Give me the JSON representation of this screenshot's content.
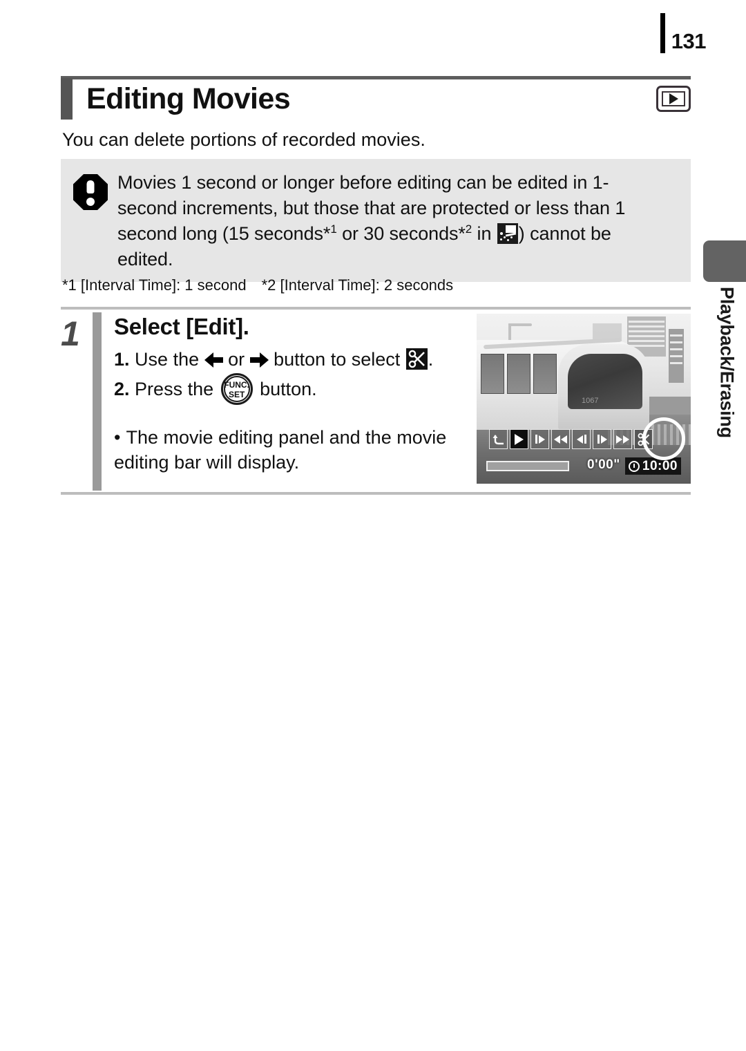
{
  "page": {
    "number": "131",
    "side_tab_label": "Playback/Erasing"
  },
  "header": {
    "title": "Editing Movies",
    "mode_icon": "playback-mode-icon"
  },
  "intro": {
    "text": "You can delete portions of recorded movies."
  },
  "caution": {
    "icon": "caution-exclamation-icon",
    "line1": "Movies 1 second or longer before editing can be edited in 1-",
    "line2": "second increments, but those that are protected or less than 1",
    "line3_a": "second long (15 seconds*",
    "line3_sup1": "1",
    "line3_b": " or 30 seconds*",
    "line3_sup2": "2",
    "line3_c": " in ",
    "line3_icon": "timelapse-movie-mode-icon",
    "line3_d": ") cannot be",
    "line4": "edited."
  },
  "footnotes": {
    "note1": "*1 [Interval Time]: 1 second",
    "note2": "*2 [Interval Time]: 2 seconds"
  },
  "step": {
    "number": "1",
    "title": "Select [Edit].",
    "sub1_num": "1.",
    "sub1_a": "Use the ",
    "sub1_b": " or ",
    "sub1_c": " button to select ",
    "sub1_icon": "scissors-edit-icon",
    "sub1_d": ".",
    "sub2_num": "2.",
    "sub2_a": "Press the ",
    "sub2_icon": "func-set-button-icon",
    "sub2_func_label": "FUNC.",
    "sub2_set_label": "SET",
    "sub2_b": " button.",
    "bullet_dot": "•",
    "bullet_text": "The movie editing panel and the movie editing bar will display."
  },
  "camera_screen": {
    "elapsed_time": "0'00\"",
    "total_time": "10:00",
    "train_number": "1067",
    "panel_buttons": [
      {
        "name": "exit-button",
        "icon": "return-arrow-icon"
      },
      {
        "name": "play-button",
        "icon": "play-icon",
        "selected": true
      },
      {
        "name": "slow-motion-button",
        "icon": "slow-motion-icon"
      },
      {
        "name": "first-frame-button",
        "icon": "skip-to-start-icon"
      },
      {
        "name": "previous-frame-button",
        "icon": "step-back-icon"
      },
      {
        "name": "next-frame-button",
        "icon": "step-forward-icon"
      },
      {
        "name": "last-frame-button",
        "icon": "skip-to-end-icon"
      },
      {
        "name": "edit-button",
        "icon": "scissors-icon",
        "highlighted": true
      }
    ]
  },
  "colors": {
    "caution_bg": "#e6e6e6",
    "rule_gray": "#bdbdbd",
    "title_bar": "#555555",
    "step_bar": "#9a9a9a",
    "side_tab": "#636363"
  }
}
